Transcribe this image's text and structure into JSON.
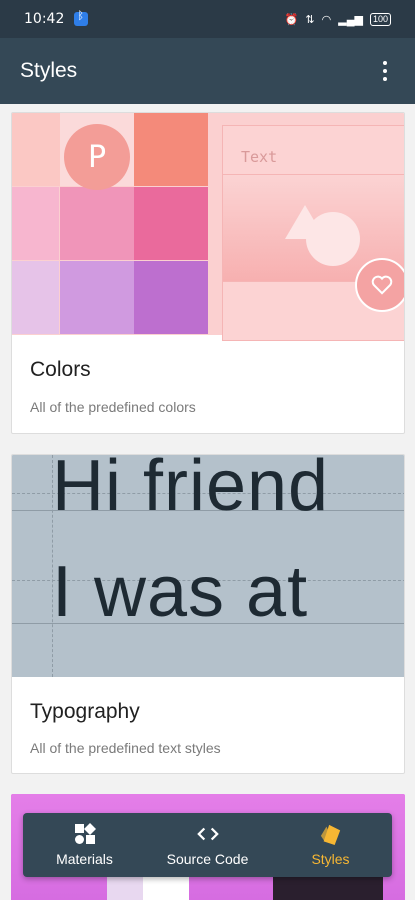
{
  "status_bar": {
    "time": "10:42",
    "battery": "100"
  },
  "app_bar": {
    "title": "Styles"
  },
  "cards": [
    {
      "title": "Colors",
      "subtitle": "All of the predefined colors",
      "avatar_letter": "P",
      "preview_text": "Text"
    },
    {
      "title": "Typography",
      "subtitle": "All of the predefined text styles",
      "sample_line_1": "Hi friend",
      "sample_line_2": "I was at"
    }
  ],
  "bottom_nav": [
    {
      "label": "Materials",
      "icon": "materials-icon",
      "active": false
    },
    {
      "label": "Source Code",
      "icon": "code-icon",
      "active": false
    },
    {
      "label": "Styles",
      "icon": "styles-icon",
      "active": true
    }
  ],
  "colors": {
    "status_bar": "#2b3a47",
    "app_bar": "#344856",
    "active_nav": "#f7b733",
    "swatches": [
      "#fbd0d0",
      "#f8d6d6",
      "#f48a7a",
      "#f7b6cf",
      "#f095b9",
      "#ea6a9c",
      "#e6c3e8",
      "#d09ae0",
      "#bd6fcf"
    ]
  }
}
